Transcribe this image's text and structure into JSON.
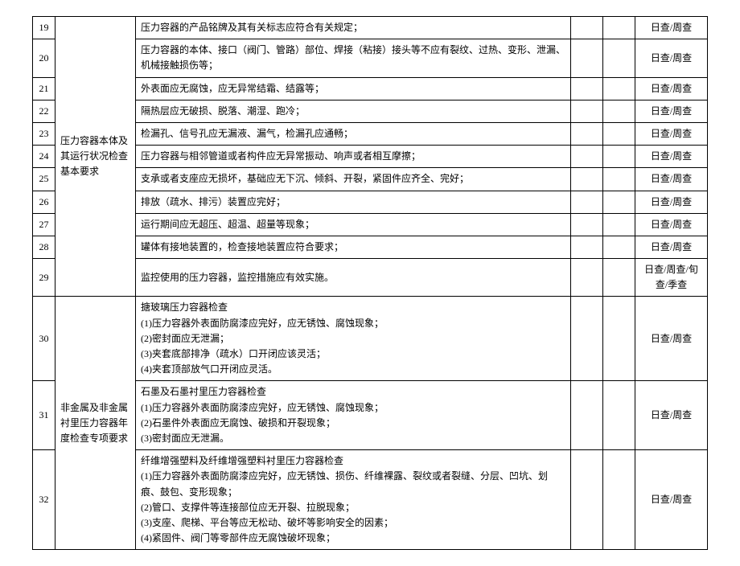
{
  "rows": [
    {
      "num": "19",
      "desc": "压力容器的产品铭牌及其有关标志应符合有关规定；",
      "freq": "日查/周查"
    },
    {
      "num": "20",
      "desc": "压力容器的本体、接口（阀门、管路）部位、焊接（粘接）接头等不应有裂纹、过热、变形、泄漏、机械接触损伤等；",
      "freq": "日查/周查"
    },
    {
      "num": "21",
      "desc": "外表面应无腐蚀，应无异常结霜、结露等；",
      "freq": "日查/周查"
    },
    {
      "num": "22",
      "desc": "隔热层应无破损、脱落、潮湿、跑冷；",
      "freq": "日查/周查"
    },
    {
      "num": "23",
      "desc": "检漏孔、信号孔应无漏液、漏气，检漏孔应通畅；",
      "freq": "日查/周查"
    },
    {
      "num": "24",
      "desc": "压力容器与相邻管道或者构件应无异常振动、响声或者相互摩擦；",
      "freq": "日查/周查"
    },
    {
      "num": "25",
      "desc": "支承或者支座应无损坏，基础应无下沉、倾斜、开裂，紧固件应齐全、完好；",
      "freq": "日查/周查"
    },
    {
      "num": "26",
      "desc": "排放（疏水、排污）装置应完好；",
      "freq": "日查/周查"
    },
    {
      "num": "27",
      "desc": "运行期间应无超压、超温、超量等现象；",
      "freq": "日查/周查"
    },
    {
      "num": "28",
      "desc": "罐体有接地装置的，检查接地装置应符合要求；",
      "freq": "日查/周查"
    },
    {
      "num": "29",
      "desc": "监控使用的压力容器，监控措施应有效实施。",
      "freq": "日查/周查/旬查/季查"
    },
    {
      "num": "30",
      "desc": "搪玻璃压力容器检查\n(1)压力容器外表面防腐漆应完好，应无锈蚀、腐蚀现象；\n(2)密封面应无泄漏；\n(3)夹套底部排净（疏水）口开闭应该灵活；\n(4)夹套顶部放气口开闭应灵活。",
      "freq": "日查/周查"
    },
    {
      "num": "31",
      "desc": "石墨及石墨衬里压力容器检查\n(1)压力容器外表面防腐漆应完好，应无锈蚀、腐蚀现象；\n(2)石墨件外表面应无腐蚀、破损和开裂现象；\n(3)密封面应无泄漏。",
      "freq": "日查/周查"
    },
    {
      "num": "32",
      "desc": "纤维增强塑料及纤维增强塑料衬里压力容器检查\n(1)压力容器外表面防腐漆应完好，应无锈蚀、损伤、纤维裸露、裂纹或者裂缝、分层、凹坑、划痕、鼓包、变形现象；\n(2)管口、支撑件等连接部位应无开裂、拉脱现象；\n(3)支座、爬梯、平台等应无松动、破坏等影响安全的因素；\n(4)紧固件、阀门等零部件应无腐蚀破坏现象；",
      "freq": "日查/周查"
    }
  ],
  "categories": {
    "cat1": "压力容器本体及其运行状况检查基本要求",
    "cat2": "非金属及非金属衬里压力容器年度检查专项要求"
  }
}
